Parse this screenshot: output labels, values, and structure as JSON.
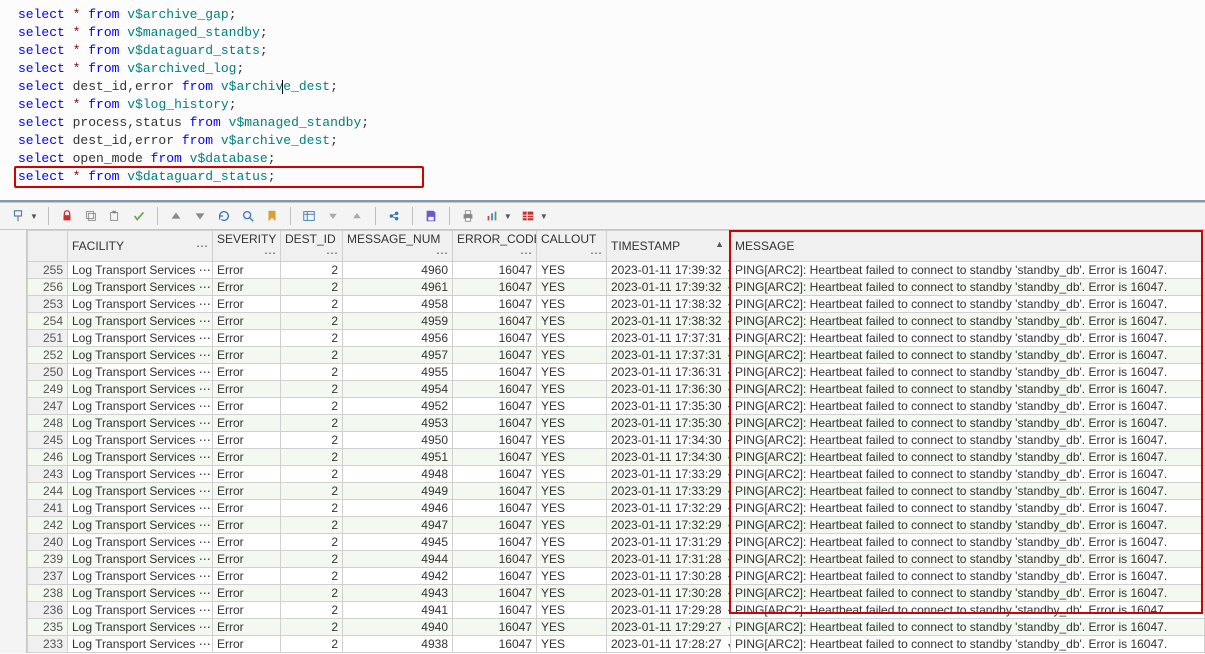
{
  "editor": {
    "lines": [
      {
        "kw": "select",
        "mid": " * ",
        "kw2": "from",
        "obj": " v$archive_gap",
        "tail": ";"
      },
      {
        "kw": "select",
        "mid": " * ",
        "kw2": "from",
        "obj": " v$managed_standby",
        "tail": ";"
      },
      {
        "kw": "select",
        "mid": " * ",
        "kw2": "from",
        "obj": " v$dataguard_stats",
        "tail": ";"
      },
      {
        "kw": "select",
        "mid": " * ",
        "kw2": "from",
        "obj": " v$archived_log",
        "tail": ";"
      },
      {
        "kw": "select",
        "mid": " dest_id,error ",
        "kw2": "from",
        "obj": " v$archive_dest",
        "tail": ";",
        "caret": true
      },
      {
        "kw": "select",
        "mid": " * ",
        "kw2": "from",
        "obj": " v$log_history",
        "tail": ";"
      },
      {
        "kw": "select",
        "mid": " process,status ",
        "kw2": "from",
        "obj": " v$managed_standby",
        "tail": ";"
      },
      {
        "kw": "select",
        "mid": " dest_id,error ",
        "kw2": "from",
        "obj": " v$archive_dest",
        "tail": ";"
      },
      {
        "kw": "select",
        "mid": " open_mode ",
        "kw2": "from",
        "obj": " v$database",
        "tail": ";"
      },
      {
        "kw": "select",
        "mid": " * ",
        "kw2": "from",
        "obj": " v$dataguard_status",
        "tail": ";"
      }
    ],
    "highlight_index": 9
  },
  "toolbar": {
    "icons": [
      "pin",
      "lock",
      "copy-row",
      "paste-row",
      "commit",
      "sort-asc",
      "sort-desc",
      "refresh",
      "find",
      "bookmark",
      "export",
      "filter-asc",
      "filter-desc",
      "format",
      "save",
      "print",
      "chart",
      "table-view"
    ]
  },
  "grid": {
    "columns": [
      {
        "key": "rownum",
        "label": ""
      },
      {
        "key": "facility",
        "label": "FACILITY",
        "ell": true
      },
      {
        "key": "severity",
        "label": "SEVERITY",
        "ell": true
      },
      {
        "key": "dest_id",
        "label": "DEST_ID",
        "ell": true
      },
      {
        "key": "message_num",
        "label": "MESSAGE_NUM",
        "ell": true
      },
      {
        "key": "error_code",
        "label": "ERROR_CODE",
        "ell": true
      },
      {
        "key": "callout",
        "label": "CALLOUT",
        "ell": true
      },
      {
        "key": "timestamp",
        "label": "TIMESTAMP",
        "sort": "asc"
      },
      {
        "key": "message",
        "label": "MESSAGE"
      }
    ],
    "rows": [
      {
        "n": 255,
        "facility": "Log Transport Services",
        "severity": "Error",
        "dest_id": 2,
        "message_num": 4960,
        "error_code": 16047,
        "callout": "YES",
        "timestamp": "2023-01-11 17:39:32",
        "message": "PING[ARC2]: Heartbeat failed to connect to standby 'standby_db'. Error is 16047.",
        "alt": false
      },
      {
        "n": 256,
        "facility": "Log Transport Services",
        "severity": "Error",
        "dest_id": 2,
        "message_num": 4961,
        "error_code": 16047,
        "callout": "YES",
        "timestamp": "2023-01-11 17:39:32",
        "message": "PING[ARC2]: Heartbeat failed to connect to standby 'standby_db'. Error is 16047.",
        "alt": true
      },
      {
        "n": 253,
        "facility": "Log Transport Services",
        "severity": "Error",
        "dest_id": 2,
        "message_num": 4958,
        "error_code": 16047,
        "callout": "YES",
        "timestamp": "2023-01-11 17:38:32",
        "message": "PING[ARC2]: Heartbeat failed to connect to standby 'standby_db'. Error is 16047.",
        "alt": false
      },
      {
        "n": 254,
        "facility": "Log Transport Services",
        "severity": "Error",
        "dest_id": 2,
        "message_num": 4959,
        "error_code": 16047,
        "callout": "YES",
        "timestamp": "2023-01-11 17:38:32",
        "message": "PING[ARC2]: Heartbeat failed to connect to standby 'standby_db'. Error is 16047.",
        "alt": true
      },
      {
        "n": 251,
        "facility": "Log Transport Services",
        "severity": "Error",
        "dest_id": 2,
        "message_num": 4956,
        "error_code": 16047,
        "callout": "YES",
        "timestamp": "2023-01-11 17:37:31",
        "message": "PING[ARC2]: Heartbeat failed to connect to standby 'standby_db'. Error is 16047.",
        "alt": false
      },
      {
        "n": 252,
        "facility": "Log Transport Services",
        "severity": "Error",
        "dest_id": 2,
        "message_num": 4957,
        "error_code": 16047,
        "callout": "YES",
        "timestamp": "2023-01-11 17:37:31",
        "message": "PING[ARC2]: Heartbeat failed to connect to standby 'standby_db'. Error is 16047.",
        "alt": true
      },
      {
        "n": 250,
        "facility": "Log Transport Services",
        "severity": "Error",
        "dest_id": 2,
        "message_num": 4955,
        "error_code": 16047,
        "callout": "YES",
        "timestamp": "2023-01-11 17:36:31",
        "message": "PING[ARC2]: Heartbeat failed to connect to standby 'standby_db'. Error is 16047.",
        "alt": false
      },
      {
        "n": 249,
        "facility": "Log Transport Services",
        "severity": "Error",
        "dest_id": 2,
        "message_num": 4954,
        "error_code": 16047,
        "callout": "YES",
        "timestamp": "2023-01-11 17:36:30",
        "message": "PING[ARC2]: Heartbeat failed to connect to standby 'standby_db'. Error is 16047.",
        "alt": true
      },
      {
        "n": 247,
        "facility": "Log Transport Services",
        "severity": "Error",
        "dest_id": 2,
        "message_num": 4952,
        "error_code": 16047,
        "callout": "YES",
        "timestamp": "2023-01-11 17:35:30",
        "message": "PING[ARC2]: Heartbeat failed to connect to standby 'standby_db'. Error is 16047.",
        "alt": false
      },
      {
        "n": 248,
        "facility": "Log Transport Services",
        "severity": "Error",
        "dest_id": 2,
        "message_num": 4953,
        "error_code": 16047,
        "callout": "YES",
        "timestamp": "2023-01-11 17:35:30",
        "message": "PING[ARC2]: Heartbeat failed to connect to standby 'standby_db'. Error is 16047.",
        "alt": true
      },
      {
        "n": 245,
        "facility": "Log Transport Services",
        "severity": "Error",
        "dest_id": 2,
        "message_num": 4950,
        "error_code": 16047,
        "callout": "YES",
        "timestamp": "2023-01-11 17:34:30",
        "message": "PING[ARC2]: Heartbeat failed to connect to standby 'standby_db'. Error is 16047.",
        "alt": false
      },
      {
        "n": 246,
        "facility": "Log Transport Services",
        "severity": "Error",
        "dest_id": 2,
        "message_num": 4951,
        "error_code": 16047,
        "callout": "YES",
        "timestamp": "2023-01-11 17:34:30",
        "message": "PING[ARC2]: Heartbeat failed to connect to standby 'standby_db'. Error is 16047.",
        "alt": true
      },
      {
        "n": 243,
        "facility": "Log Transport Services",
        "severity": "Error",
        "dest_id": 2,
        "message_num": 4948,
        "error_code": 16047,
        "callout": "YES",
        "timestamp": "2023-01-11 17:33:29",
        "message": "PING[ARC2]: Heartbeat failed to connect to standby 'standby_db'. Error is 16047.",
        "alt": false
      },
      {
        "n": 244,
        "facility": "Log Transport Services",
        "severity": "Error",
        "dest_id": 2,
        "message_num": 4949,
        "error_code": 16047,
        "callout": "YES",
        "timestamp": "2023-01-11 17:33:29",
        "message": "PING[ARC2]: Heartbeat failed to connect to standby 'standby_db'. Error is 16047.",
        "alt": true
      },
      {
        "n": 241,
        "facility": "Log Transport Services",
        "severity": "Error",
        "dest_id": 2,
        "message_num": 4946,
        "error_code": 16047,
        "callout": "YES",
        "timestamp": "2023-01-11 17:32:29",
        "message": "PING[ARC2]: Heartbeat failed to connect to standby 'standby_db'. Error is 16047.",
        "alt": false
      },
      {
        "n": 242,
        "facility": "Log Transport Services",
        "severity": "Error",
        "dest_id": 2,
        "message_num": 4947,
        "error_code": 16047,
        "callout": "YES",
        "timestamp": "2023-01-11 17:32:29",
        "message": "PING[ARC2]: Heartbeat failed to connect to standby 'standby_db'. Error is 16047.",
        "alt": true
      },
      {
        "n": 240,
        "facility": "Log Transport Services",
        "severity": "Error",
        "dest_id": 2,
        "message_num": 4945,
        "error_code": 16047,
        "callout": "YES",
        "timestamp": "2023-01-11 17:31:29",
        "message": "PING[ARC2]: Heartbeat failed to connect to standby 'standby_db'. Error is 16047.",
        "alt": false
      },
      {
        "n": 239,
        "facility": "Log Transport Services",
        "severity": "Error",
        "dest_id": 2,
        "message_num": 4944,
        "error_code": 16047,
        "callout": "YES",
        "timestamp": "2023-01-11 17:31:28",
        "message": "PING[ARC2]: Heartbeat failed to connect to standby 'standby_db'. Error is 16047.",
        "alt": true
      },
      {
        "n": 237,
        "facility": "Log Transport Services",
        "severity": "Error",
        "dest_id": 2,
        "message_num": 4942,
        "error_code": 16047,
        "callout": "YES",
        "timestamp": "2023-01-11 17:30:28",
        "message": "PING[ARC2]: Heartbeat failed to connect to standby 'standby_db'. Error is 16047.",
        "alt": false
      },
      {
        "n": 238,
        "facility": "Log Transport Services",
        "severity": "Error",
        "dest_id": 2,
        "message_num": 4943,
        "error_code": 16047,
        "callout": "YES",
        "timestamp": "2023-01-11 17:30:28",
        "message": "PING[ARC2]: Heartbeat failed to connect to standby 'standby_db'. Error is 16047.",
        "alt": true
      },
      {
        "n": 236,
        "facility": "Log Transport Services",
        "severity": "Error",
        "dest_id": 2,
        "message_num": 4941,
        "error_code": 16047,
        "callout": "YES",
        "timestamp": "2023-01-11 17:29:28",
        "message": "PING[ARC2]: Heartbeat failed to connect to standby 'standby_db'. Error is 16047.",
        "alt": false
      },
      {
        "n": 235,
        "facility": "Log Transport Services",
        "severity": "Error",
        "dest_id": 2,
        "message_num": 4940,
        "error_code": 16047,
        "callout": "YES",
        "timestamp": "2023-01-11 17:29:27",
        "message": "PING[ARC2]: Heartbeat failed to connect to standby 'standby_db'. Error is 16047.",
        "alt": true
      },
      {
        "n": 233,
        "facility": "Log Transport Services",
        "severity": "Error",
        "dest_id": 2,
        "message_num": 4938,
        "error_code": 16047,
        "callout": "YES",
        "timestamp": "2023-01-11 17:28:27",
        "message": "PING[ARC2]: Heartbeat failed to connect to standby 'standby_db'. Error is 16047.",
        "alt": false
      }
    ],
    "red_box_rows": 19
  }
}
